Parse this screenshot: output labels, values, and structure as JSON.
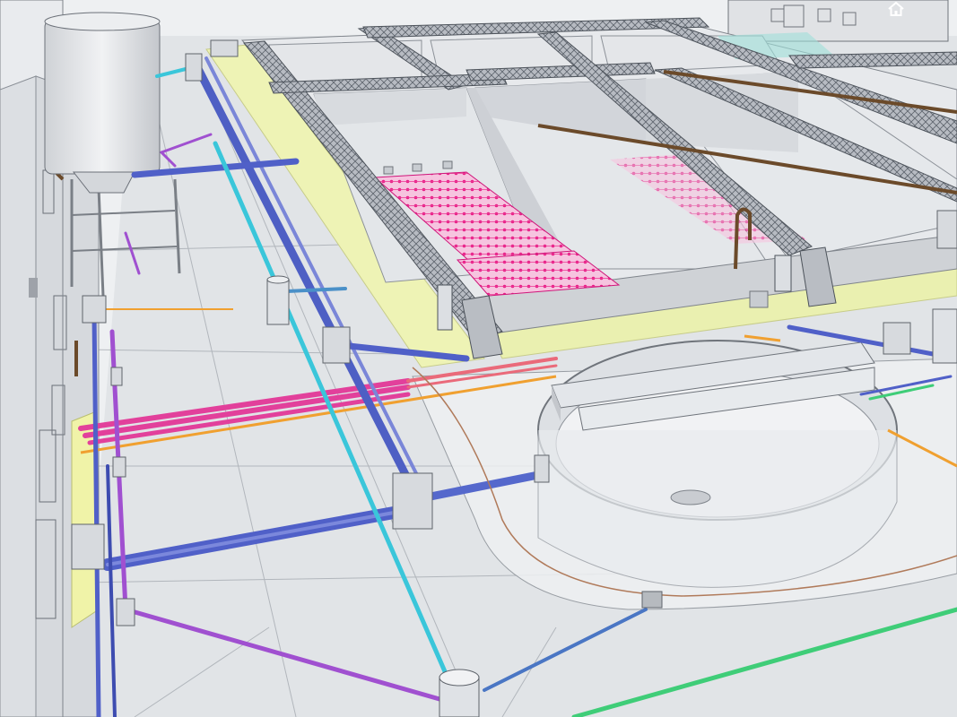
{
  "viewer": {
    "home_icon": "home-icon",
    "home_action": "home-view"
  },
  "colors": {
    "sky": "#f2f4f6",
    "ground": "#e2e5e8",
    "walkway_yellow": "#eef2b8",
    "pipe_magenta": "#e0409a",
    "pipe_blue": "#4f63c9",
    "pipe_cyan": "#39c9dc",
    "pipe_purple": "#a24fd0",
    "pipe_green": "#3fd07a",
    "pipe_orange": "#f0a030",
    "pipe_red": "#e85060",
    "pipe_brown": "#6b4a2a",
    "diffuser_pink": "#f02a8c",
    "tank_wall": "#d3d6da",
    "structure_gray": "#c9ccd1"
  }
}
